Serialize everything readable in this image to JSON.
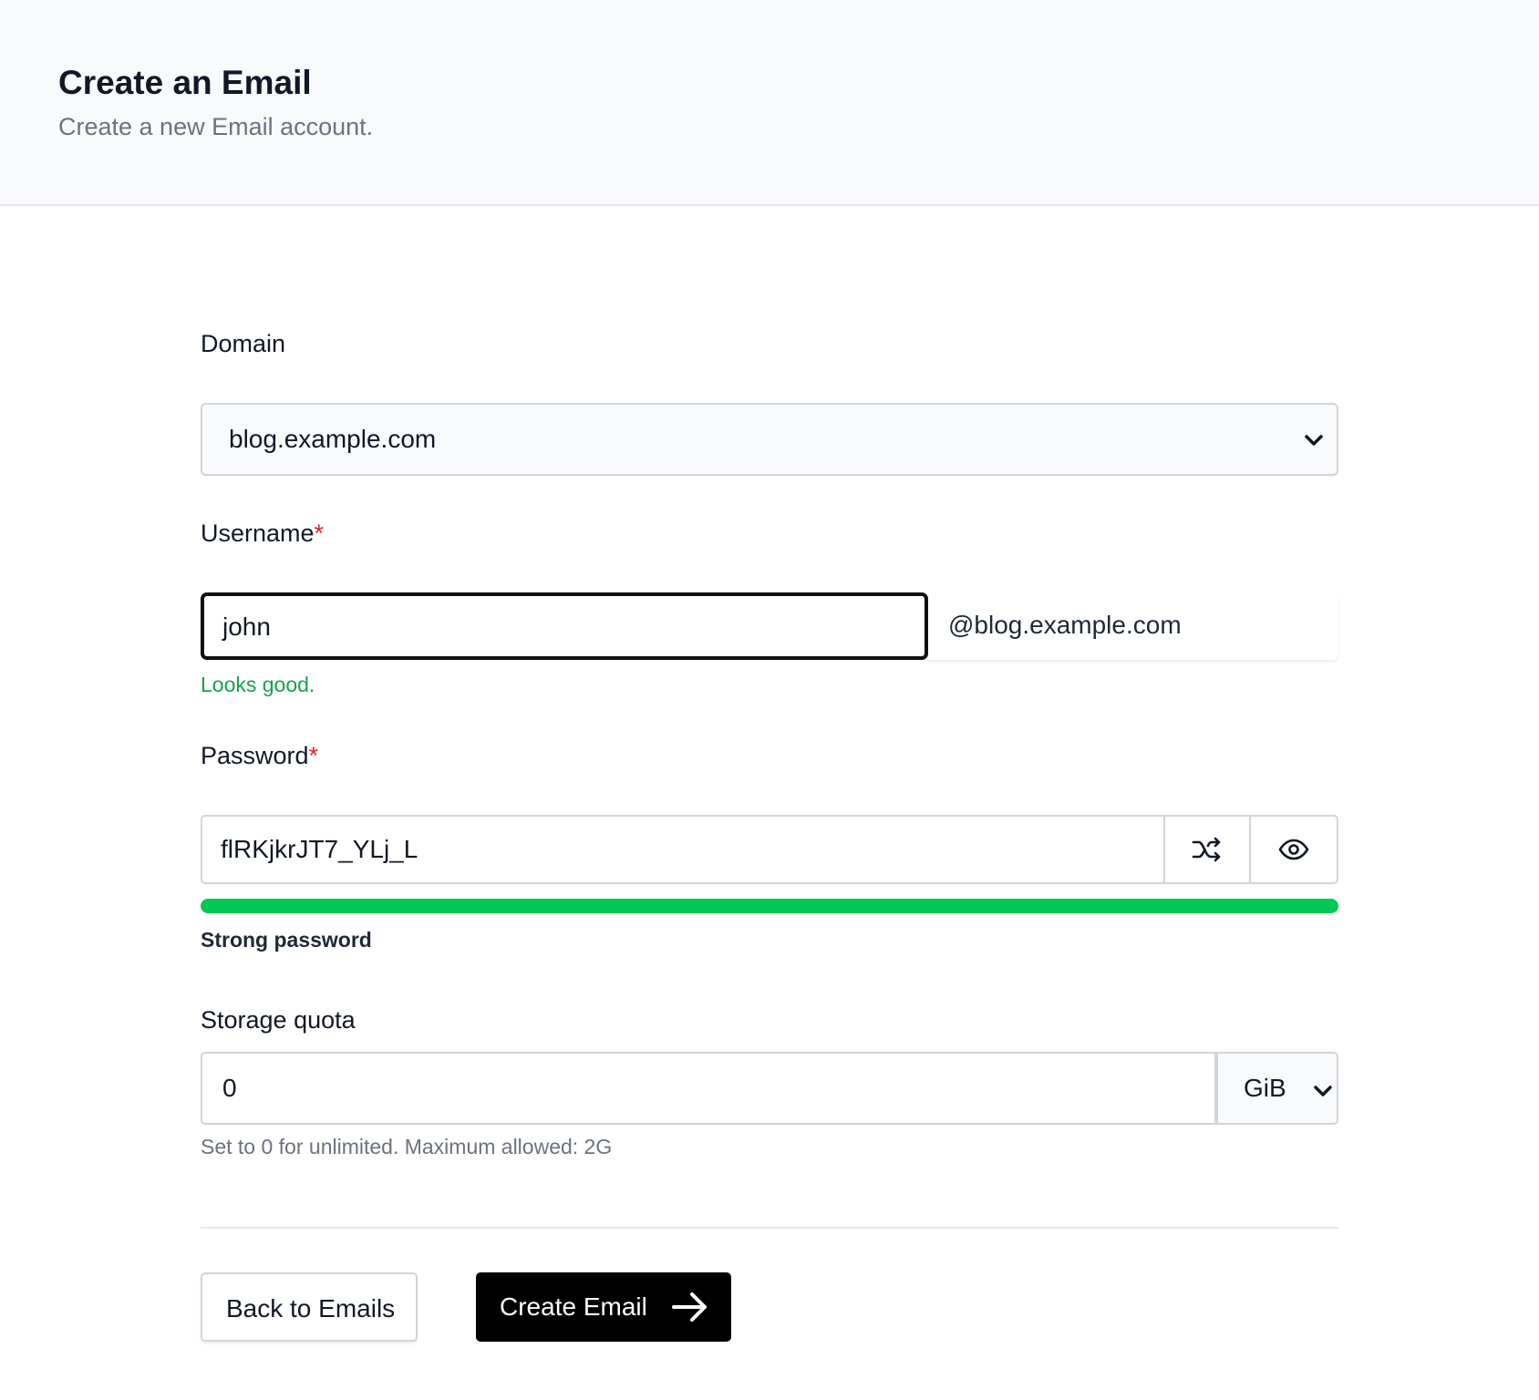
{
  "header": {
    "title": "Create an Email",
    "subtitle": "Create a new Email account."
  },
  "form": {
    "domain": {
      "label": "Domain",
      "selected": "blog.example.com",
      "icon": "chevron-down-icon"
    },
    "username": {
      "label": "Username",
      "required_mark": "*",
      "value": "john",
      "suffix": "@blog.example.com",
      "feedback": "Looks good."
    },
    "password": {
      "label": "Password",
      "required_mark": "*",
      "value": "flRKjkrJT7_YLj_L",
      "generate_icon": "shuffle-icon",
      "toggle_icon": "eye-icon",
      "strength_fraction": 1.0,
      "strength_label": "Strong password",
      "strength_color": "#00c853"
    },
    "storage_quota": {
      "label": "Storage quota",
      "value": "0",
      "unit": "GiB",
      "help": "Set to 0 for unlimited. Maximum allowed: 2G"
    }
  },
  "actions": {
    "back_label": "Back to Emails",
    "create_label": "Create Email",
    "create_icon": "arrow-right-icon"
  },
  "colors": {
    "accent": "#000000",
    "valid": "#16a34a",
    "required": "#dc2626"
  }
}
